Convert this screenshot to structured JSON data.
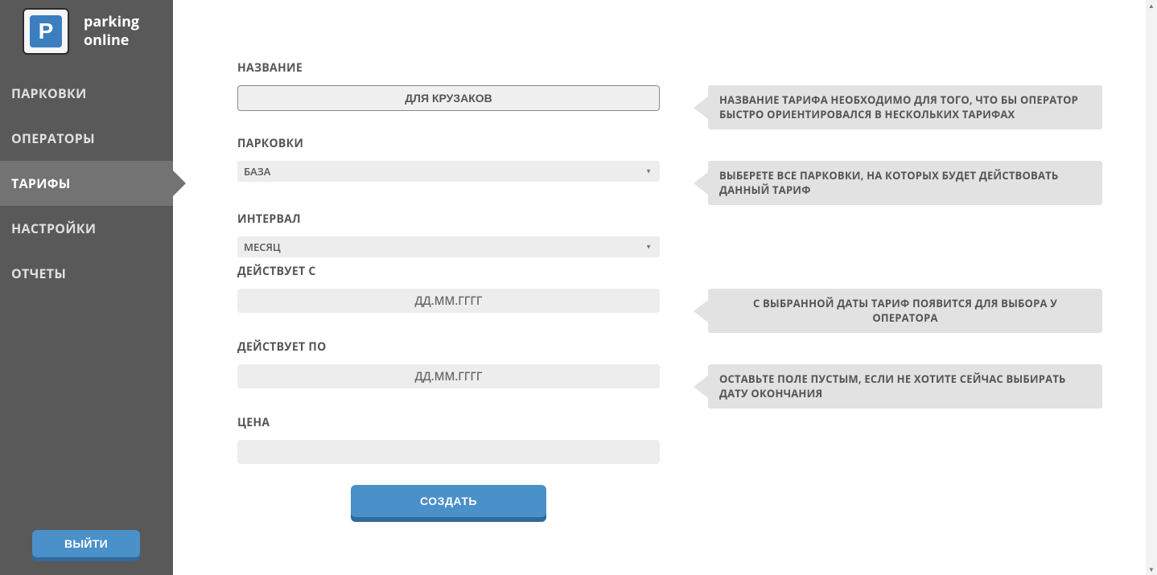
{
  "app": {
    "title_line1": "parking",
    "title_line2": "online",
    "logo_letter": "P"
  },
  "sidebar": {
    "items": [
      {
        "label": "ПАРКОВКИ",
        "active": false
      },
      {
        "label": "ОПЕРАТОРЫ",
        "active": false
      },
      {
        "label": "ТАРИФЫ",
        "active": true
      },
      {
        "label": "НАСТРОЙКИ",
        "active": false
      },
      {
        "label": "ОТЧЕТЫ",
        "active": false
      }
    ],
    "logout_label": "ВЫЙТИ"
  },
  "form": {
    "name": {
      "label": "НАЗВАНИЕ",
      "value": "ДЛЯ КРУЗАКОВ",
      "hint": "НАЗВАНИЕ ТАРИФА НЕОБХОДИМО ДЛЯ ТОГО, ЧТО БЫ ОПЕРАТОР БЫСТРО ОРИЕНТИРОВАЛСЯ В НЕСКОЛЬКИХ ТАРИФАХ"
    },
    "parkings": {
      "label": "ПАРКОВКИ",
      "selected": "БАЗА",
      "hint": "ВЫБЕРЕТЕ ВСЕ ПАРКОВКИ, НА КОТОРЫХ БУДЕТ ДЕЙСТВОВАТЬ ДАННЫЙ ТАРИФ"
    },
    "interval": {
      "label": "ИНТЕРВАЛ",
      "selected": "МЕСЯЦ"
    },
    "valid_from": {
      "label": "ДЕЙСТВУЕТ С",
      "placeholder": "ДД.ММ.ГГГГ",
      "hint": "С ВЫБРАННОЙ ДАТЫ ТАРИФ ПОЯВИТСЯ ДЛЯ ВЫБОРА У ОПЕРАТОРА"
    },
    "valid_to": {
      "label": "ДЕЙСТВУЕТ ПО",
      "placeholder": "ДД.ММ.ГГГГ",
      "hint": "ОСТАВЬТЕ ПОЛЕ ПУСТЫМ, ЕСЛИ НЕ ХОТИТЕ СЕЙЧАС ВЫБИРАТЬ ДАТУ ОКОНЧАНИЯ"
    },
    "price": {
      "label": "ЦЕНА",
      "value": ""
    },
    "submit_label": "СОЗДАТЬ"
  }
}
